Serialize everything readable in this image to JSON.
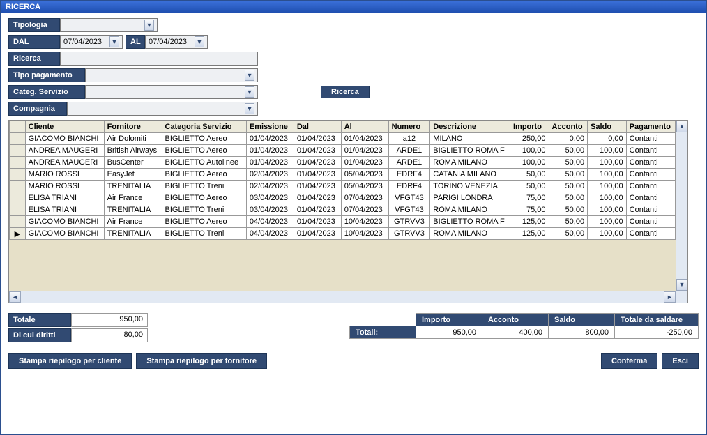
{
  "window": {
    "title": "RICERCA"
  },
  "filters": {
    "tipologia": {
      "label": "Tipologia",
      "value": ""
    },
    "dal": {
      "label": "DAL",
      "value": "07/04/2023"
    },
    "al": {
      "label": "AL",
      "value": "07/04/2023"
    },
    "ricerca": {
      "label": "Ricerca",
      "value": ""
    },
    "tipo_pagamento": {
      "label": "Tipo pagamento",
      "value": ""
    },
    "categ_servizio": {
      "label": "Categ. Servizio",
      "value": ""
    },
    "compagnia": {
      "label": "Compagnia",
      "value": ""
    }
  },
  "search_button": "Ricerca",
  "columns": [
    "Cliente",
    "Fornitore",
    "Categoria Servizio",
    "Emissione",
    "Dal",
    "Al",
    "Numero",
    "Descrizione",
    "Importo",
    "Acconto",
    "Saldo",
    "Pagamento"
  ],
  "rows": [
    {
      "marker": "",
      "cliente": "GIACOMO BIANCHI",
      "fornitore": "Air Dolomiti",
      "categoria": "BIGLIETTO Aereo",
      "emissione": "01/04/2023",
      "dal": "01/04/2023",
      "al": "01/04/2023",
      "numero": "a12",
      "descrizione": "MILANO",
      "importo": "250,00",
      "acconto": "0,00",
      "saldo": "0,00",
      "pagamento": "Contanti"
    },
    {
      "marker": "",
      "cliente": "ANDREA MAUGERI",
      "fornitore": "British Airways",
      "categoria": "BIGLIETTO Aereo",
      "emissione": "01/04/2023",
      "dal": "01/04/2023",
      "al": "01/04/2023",
      "numero": "ARDE1",
      "descrizione": "BIGLIETTO ROMA F",
      "importo": "100,00",
      "acconto": "50,00",
      "saldo": "100,00",
      "pagamento": "Contanti"
    },
    {
      "marker": "",
      "cliente": "ANDREA MAUGERI",
      "fornitore": "BusCenter",
      "categoria": "BIGLIETTO Autolinee",
      "emissione": "01/04/2023",
      "dal": "01/04/2023",
      "al": "01/04/2023",
      "numero": "ARDE1",
      "descrizione": "ROMA MILANO",
      "importo": "100,00",
      "acconto": "50,00",
      "saldo": "100,00",
      "pagamento": "Contanti"
    },
    {
      "marker": "",
      "cliente": "MARIO ROSSI",
      "fornitore": "EasyJet",
      "categoria": "BIGLIETTO Aereo",
      "emissione": "02/04/2023",
      "dal": "01/04/2023",
      "al": "05/04/2023",
      "numero": "EDRF4",
      "descrizione": "CATANIA MILANO",
      "importo": "50,00",
      "acconto": "50,00",
      "saldo": "100,00",
      "pagamento": "Contanti"
    },
    {
      "marker": "",
      "cliente": "MARIO ROSSI",
      "fornitore": "TRENITALIA",
      "categoria": "BIGLIETTO Treni",
      "emissione": "02/04/2023",
      "dal": "01/04/2023",
      "al": "05/04/2023",
      "numero": "EDRF4",
      "descrizione": "TORINO VENEZIA",
      "importo": "50,00",
      "acconto": "50,00",
      "saldo": "100,00",
      "pagamento": "Contanti"
    },
    {
      "marker": "",
      "cliente": "ELISA TRIANI",
      "fornitore": "Air France",
      "categoria": "BIGLIETTO Aereo",
      "emissione": "03/04/2023",
      "dal": "01/04/2023",
      "al": "07/04/2023",
      "numero": "VFGT43",
      "descrizione": "PARIGI LONDRA",
      "importo": "75,00",
      "acconto": "50,00",
      "saldo": "100,00",
      "pagamento": "Contanti"
    },
    {
      "marker": "",
      "cliente": "ELISA TRIANI",
      "fornitore": "TRENITALIA",
      "categoria": "BIGLIETTO Treni",
      "emissione": "03/04/2023",
      "dal": "01/04/2023",
      "al": "07/04/2023",
      "numero": "VFGT43",
      "descrizione": "ROMA MILANO",
      "importo": "75,00",
      "acconto": "50,00",
      "saldo": "100,00",
      "pagamento": "Contanti"
    },
    {
      "marker": "",
      "cliente": "GIACOMO BIANCHI",
      "fornitore": "Air France",
      "categoria": "BIGLIETTO Aereo",
      "emissione": "04/04/2023",
      "dal": "01/04/2023",
      "al": "10/04/2023",
      "numero": "GTRVV3",
      "descrizione": "BIGLIETTO ROMA F",
      "importo": "125,00",
      "acconto": "50,00",
      "saldo": "100,00",
      "pagamento": "Contanti"
    },
    {
      "marker": "▶",
      "cliente": "GIACOMO BIANCHI",
      "fornitore": "TRENITALIA",
      "categoria": "BIGLIETTO Treni",
      "emissione": "04/04/2023",
      "dal": "01/04/2023",
      "al": "10/04/2023",
      "numero": "GTRVV3",
      "descrizione": "ROMA MILANO",
      "importo": "125,00",
      "acconto": "50,00",
      "saldo": "100,00",
      "pagamento": "Contanti"
    }
  ],
  "totals_left": {
    "totale": {
      "label": "Totale",
      "value": "950,00"
    },
    "di_cui_diritti": {
      "label": "Di cui diritti",
      "value": "80,00"
    }
  },
  "totals_grid": {
    "headers": {
      "importo": "Importo",
      "acconto": "Acconto",
      "saldo": "Saldo",
      "totale_da_saldare": "Totale da saldare"
    },
    "row_label": "Totali:",
    "importo": "950,00",
    "acconto": "400,00",
    "saldo": "800,00",
    "totale_da_saldare": "-250,00"
  },
  "buttons": {
    "stampa_cliente": "Stampa riepilogo per cliente",
    "stampa_fornitore": "Stampa riepilogo per fornitore",
    "conferma": "Conferma",
    "esci": "Esci"
  }
}
